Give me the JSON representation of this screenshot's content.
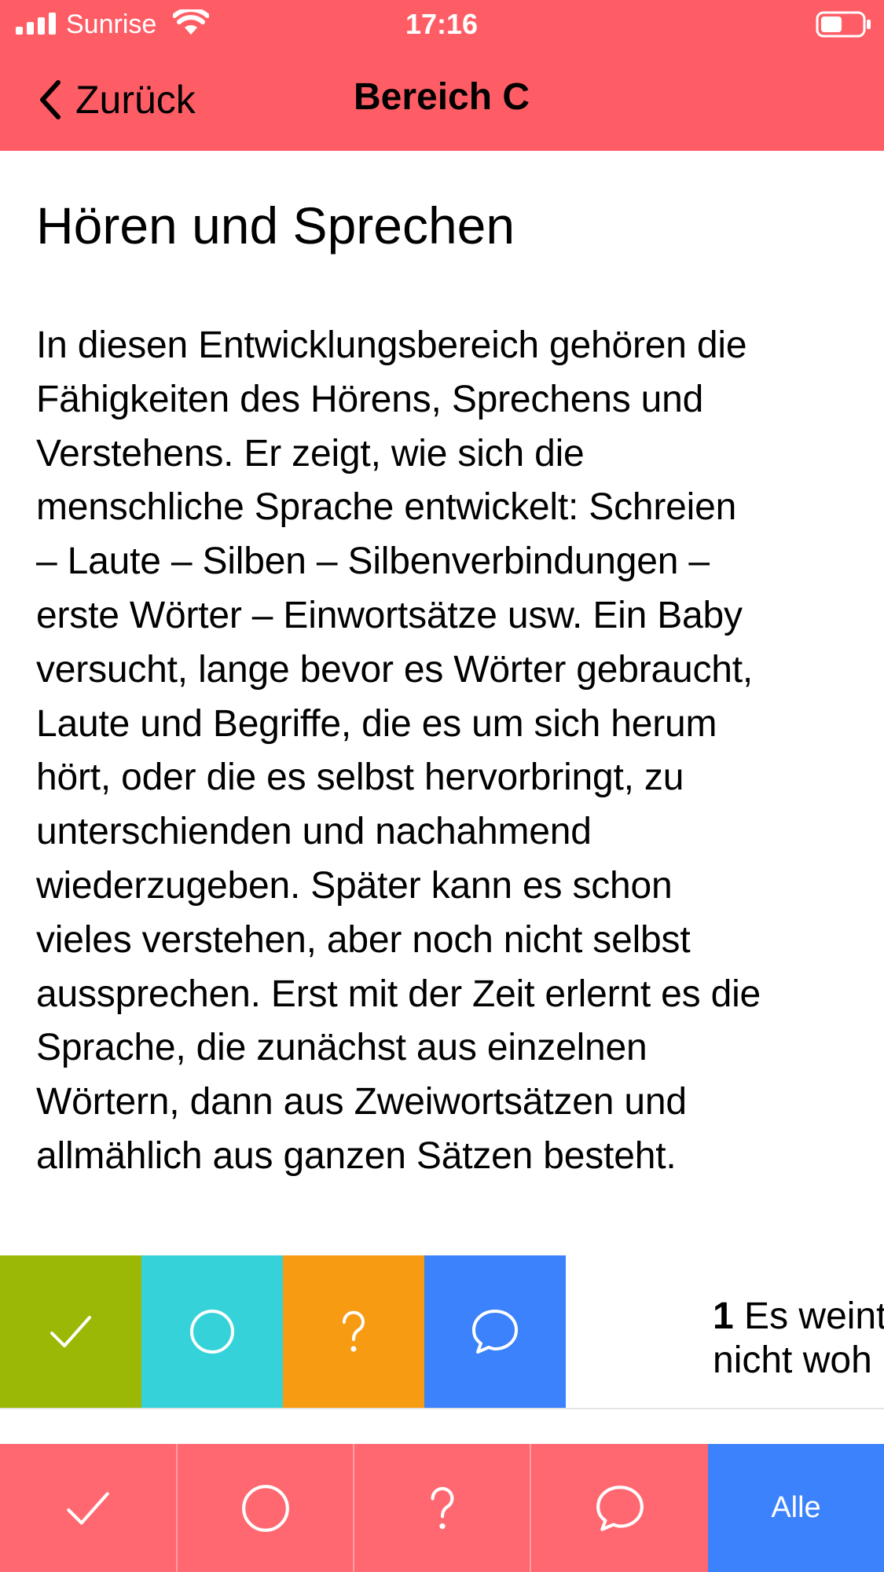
{
  "status_bar": {
    "carrier": "Sunrise",
    "time": "17:16",
    "icons": [
      "signal-icon",
      "wifi-icon",
      "battery-icon"
    ]
  },
  "nav": {
    "back_label": "Zurück",
    "title": "Bereich C"
  },
  "content": {
    "title": "Hören und Sprechen",
    "body_lines": [
      "In diesen Entwicklungsbereich gehören die",
      "Fähigkeiten des Hörens, Sprechens und",
      "Verstehens. Er zeigt, wie sich die",
      "menschliche Sprache entwickelt: Schreien",
      "– Laute – Silben – Silbenverbindungen –",
      "erste Wörter – Einwortsätze usw. Ein Baby",
      "versucht, lange bevor es Wörter gebraucht,",
      "Laute und Begriffe, die es um sich herum",
      "hört, oder die es selbst hervorbringt, zu",
      "unterschienden und nachahmend",
      "wiederzugeben. Später kann es schon",
      "vieles verstehen, aber noch nicht selbst",
      "aussprechen. Erst mit der Zeit erlernt es die",
      "Sprache, die zunächst aus einzelnen",
      "Wörtern, dann aus Zweiwortsätzen und",
      "allmählich aus ganzen Sätzen besteht."
    ]
  },
  "item_row": {
    "number": "1",
    "text_line1": "Es weint",
    "text_line2": "nicht woh",
    "actions": [
      {
        "name": "done",
        "icon": "checkmark-icon",
        "color": "#9CB806"
      },
      {
        "name": "open",
        "icon": "circle-icon",
        "color": "#35D3D9"
      },
      {
        "name": "question",
        "icon": "question-mark-icon",
        "color": "#F79B12"
      },
      {
        "name": "comment",
        "icon": "speech-bubble-icon",
        "color": "#3B82FC"
      }
    ]
  },
  "toolbar": {
    "filters": [
      {
        "icon": "checkmark-icon"
      },
      {
        "icon": "circle-icon"
      },
      {
        "icon": "question-mark-icon"
      },
      {
        "icon": "speech-bubble-icon"
      }
    ],
    "all_label": "Alle"
  },
  "colors": {
    "header_bg": "#FF5D65",
    "toolbar_bg": "#FF6870",
    "accent_blue": "#3B82FC",
    "done_green": "#9CB806",
    "open_cyan": "#35D3D9",
    "question_orange": "#F79B12"
  }
}
